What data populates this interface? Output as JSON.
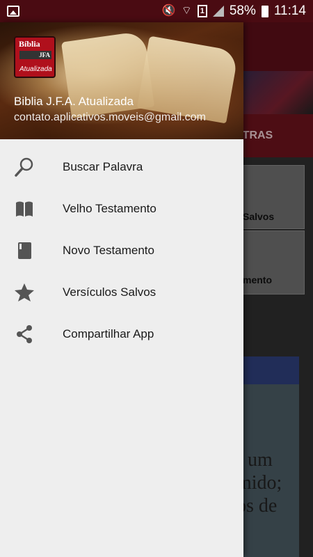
{
  "status_bar": {
    "battery": "58%",
    "time": "11:14",
    "sim": "1"
  },
  "background": {
    "tab_partial": "XTRAS",
    "card1_partial": "Salvos",
    "card2_partial": "mento",
    "panel_lines": [
      "um",
      "mido;",
      "os de"
    ]
  },
  "drawer": {
    "logo": {
      "line1": "Bíblia",
      "line2": "JFA",
      "line3": "Atualizada"
    },
    "title": "Biblia J.F.A. Atualizada",
    "email": "contato.aplicativos.moveis@gmail.com",
    "items": [
      {
        "label": "Buscar Palavra",
        "icon": "search-icon"
      },
      {
        "label": "Velho Testamento",
        "icon": "open-book-icon"
      },
      {
        "label": "Novo Testamento",
        "icon": "closed-book-icon"
      },
      {
        "label": "Versículos Salvos",
        "icon": "star-icon"
      },
      {
        "label": "Compartilhar App",
        "icon": "share-icon"
      }
    ]
  },
  "colors": {
    "primary_dark": "#4a0b12",
    "primary": "#6b131d",
    "drawer_bg": "#eeeeee",
    "icon_gray": "#555555"
  }
}
